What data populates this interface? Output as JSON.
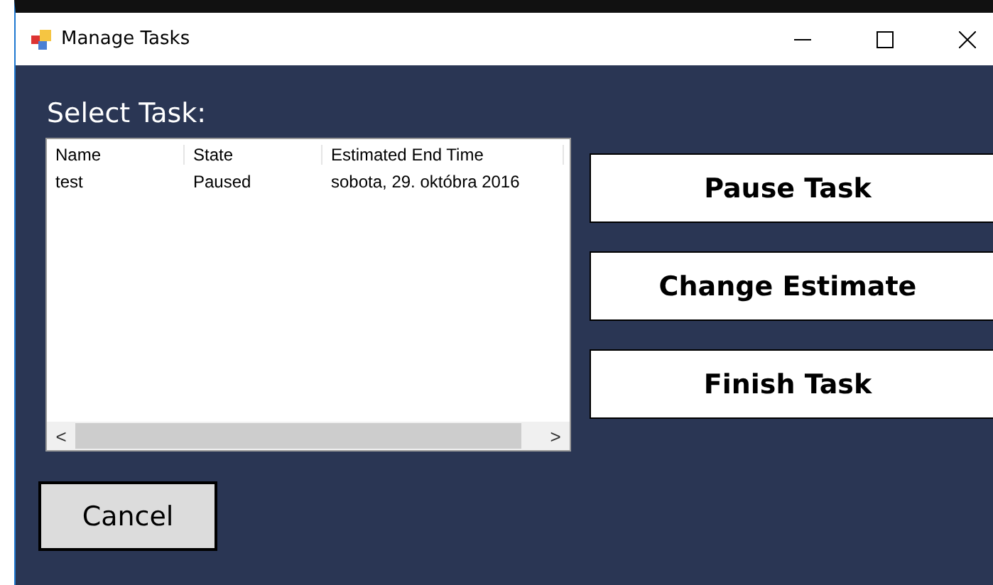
{
  "window": {
    "title": "Manage Tasks"
  },
  "heading": "Select Task:",
  "table": {
    "columns": [
      "Name",
      "State",
      "Estimated End Time"
    ],
    "rows": [
      {
        "cells": [
          "test",
          "Paused",
          "sobota, 29. októbra 2016"
        ]
      }
    ],
    "scroll_left": "<",
    "scroll_right": ">"
  },
  "actions": [
    "Pause Task",
    "Change Estimate",
    "Finish Task"
  ],
  "cancel": "Cancel"
}
